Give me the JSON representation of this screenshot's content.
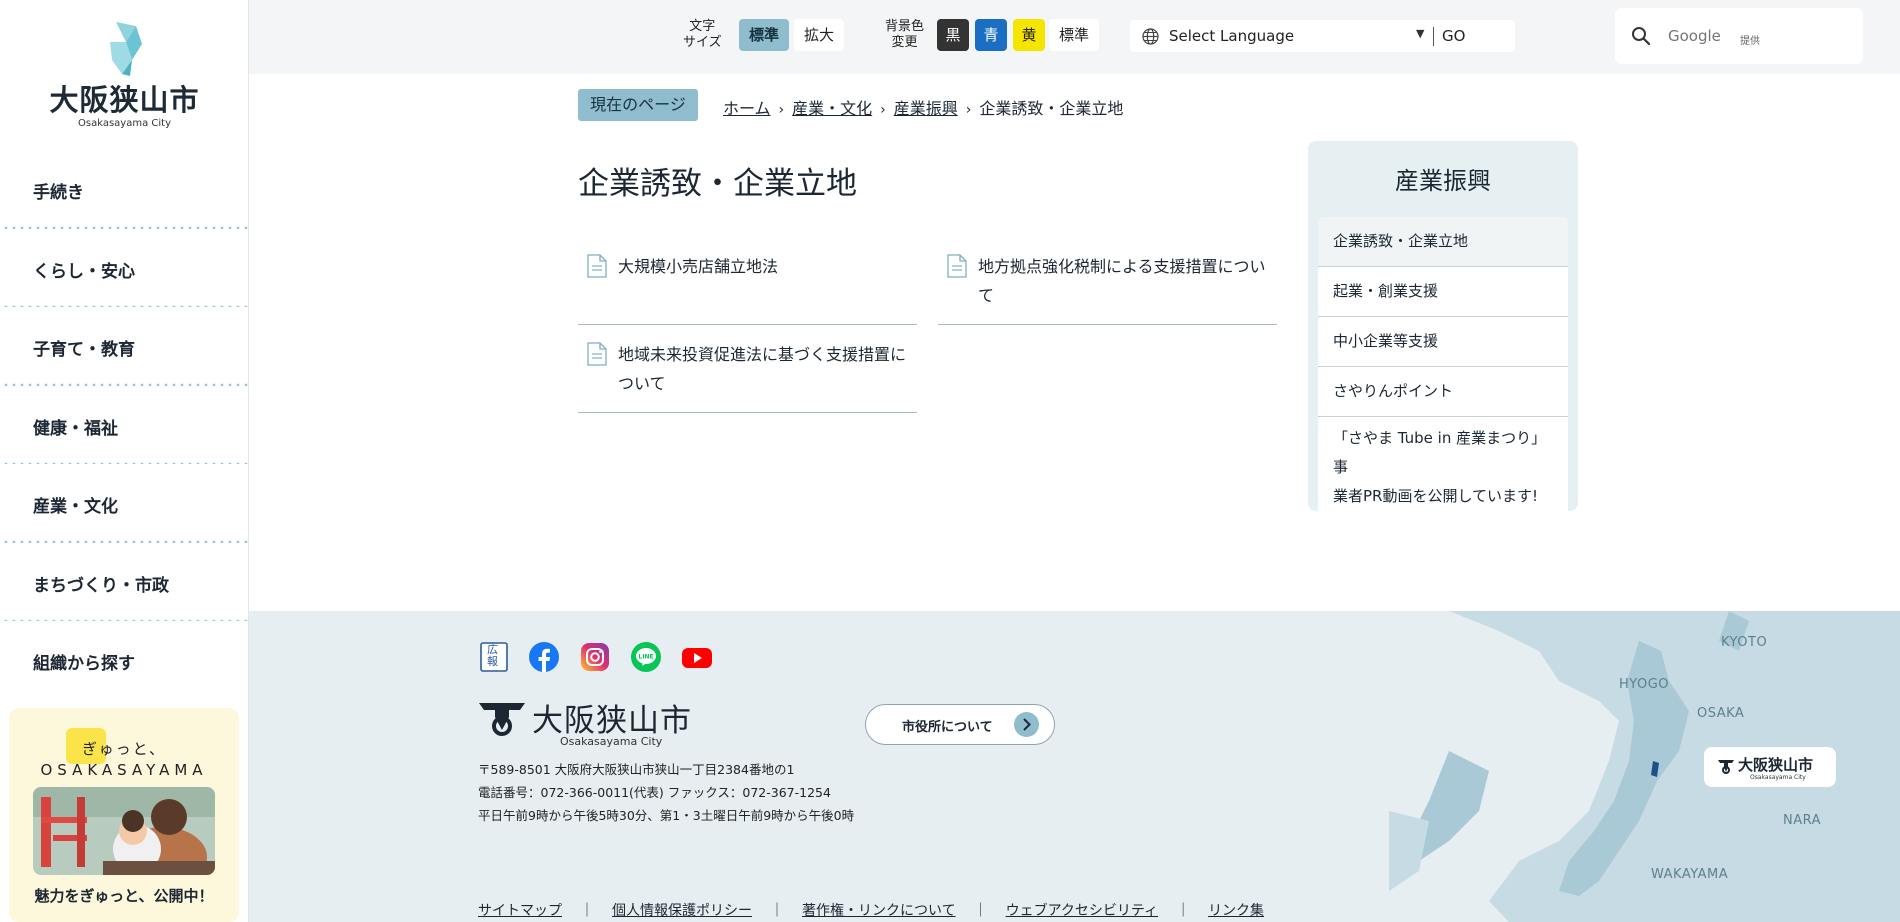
{
  "site": {
    "name": "大阪狭山市",
    "name_en": "Osakasayama City"
  },
  "nav": {
    "items": [
      {
        "label": "手続き"
      },
      {
        "label": "くらし・安心"
      },
      {
        "label": "子育て・教育"
      },
      {
        "label": "健康・福祉"
      },
      {
        "label": "産業・文化"
      },
      {
        "label": "まちづくり・市政"
      },
      {
        "label": "組織から探す"
      }
    ]
  },
  "promo": {
    "line1": "ぎゅっと、",
    "line2": "OSAKASAYAMA",
    "caption": "魅力をぎゅっと、公開中！"
  },
  "topbar": {
    "text_size_label_1": "文字",
    "text_size_label_2": "サイズ",
    "text_size_standard": "標準",
    "text_size_large": "拡大",
    "bg_color_label_1": "背景色",
    "bg_color_label_2": "変更",
    "bg_black": "黒",
    "bg_blue": "青",
    "bg_yellow": "黄",
    "bg_standard": "標準",
    "language_select": "Select Language",
    "go_label": "GO",
    "search_placeholder": "Google",
    "search_provided": "提供"
  },
  "breadcrumb": {
    "current_tag": "現在のページ",
    "items": [
      "ホーム",
      "産業・文化",
      "産業振興"
    ],
    "current": "企業誘致・企業立地"
  },
  "main": {
    "title": "企業誘致・企業立地",
    "links": [
      {
        "line1": "大規模小売店舗立地法",
        "line2": ""
      },
      {
        "line1": "地方拠点強化税制による支援措置につい",
        "line2": "て"
      },
      {
        "line1": "地域未来投資促進法に基づく支援措置に",
        "line2": "ついて"
      }
    ]
  },
  "sidemenu": {
    "title": "産業振興",
    "items": [
      {
        "label": "企業誘致・企業立地"
      },
      {
        "label": "起業・創業支援"
      },
      {
        "label": "中小企業等支援"
      },
      {
        "label": "さやりんポイント"
      },
      {
        "label_1": "「さやま Tube in 産業まつり」事",
        "label_2": "業者PR動画を公開しています!"
      }
    ]
  },
  "footer": {
    "social": [
      "kouhou-icon",
      "facebook-icon",
      "instagram-icon",
      "line-icon",
      "youtube-icon"
    ],
    "kouhou_1": "広",
    "kouhou_2": "報",
    "city_hall_button": "市役所について",
    "address": "〒589-8501 大阪府大阪狭山市狭山一丁目2384番地の1",
    "phone": "電話番号：072-366-0011(代表) ファックス：072-367-1254",
    "hours": "平日午前9時から午後5時30分、第1・3土曜日午前9時から午後0時",
    "links": [
      "サイトマップ",
      "個人情報保護ポリシー",
      "著作権・リンクについて",
      "ウェブアクセシビリティ",
      "リンク集"
    ],
    "separator": "｜",
    "map_labels": {
      "kyoto": "KYOTO",
      "hyogo": "HYOGO",
      "osaka": "OSAKA",
      "nara": "NARA",
      "wakayama": "WAKAYAMA"
    }
  },
  "colors": {
    "accent": "#8fbdce",
    "nav_text": "#1c2733",
    "footer_bg": "#e6eef1",
    "sidemenu_bg": "#e6eff2",
    "map_land": "#c6dbe4",
    "map_water": "#a9c9d6"
  }
}
